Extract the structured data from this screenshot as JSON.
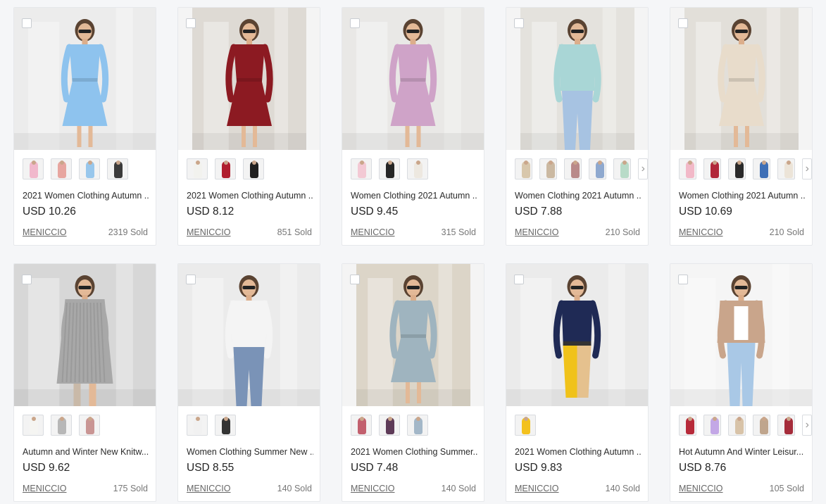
{
  "products": [
    {
      "title": "2021 Women Clothing Autumn ...",
      "price": "USD 10.26",
      "seller": "MENICCIO",
      "sold": "2319 Sold",
      "photo": {
        "bg": "#ececec",
        "outfit": "#8ec3ee",
        "accent": "#ffffff",
        "style": "dress",
        "fit": "full"
      },
      "swatches": [
        "#f1b8cc",
        "#e7a6a0",
        "#98c7ec",
        "#3b3b3b"
      ],
      "more": false
    },
    {
      "title": "2021 Women Clothing Autumn ...",
      "price": "USD 8.12",
      "seller": "MENICCIO",
      "sold": "851 Sold",
      "photo": {
        "bg": "#dedad4",
        "outfit": "#8c1a22",
        "accent": "#8c1a22",
        "style": "dress",
        "fit": "narrow"
      },
      "swatches": [
        "#f2f2ee",
        "#b01e2e",
        "#1f1f1f"
      ],
      "more": false
    },
    {
      "title": "Women Clothing 2021 Autumn ...",
      "price": "USD 9.45",
      "seller": "MENICCIO",
      "sold": "315 Sold",
      "photo": {
        "bg": "#e9e8e6",
        "outfit": "#cfa3c8",
        "accent": "#cfa3c8",
        "style": "dress",
        "fit": "full"
      },
      "swatches": [
        "#f3c9d4",
        "#262626",
        "#ede8e0"
      ],
      "more": false
    },
    {
      "title": "Women Clothing 2021 Autumn ...",
      "price": "USD 7.88",
      "seller": "MENICCIO",
      "sold": "210 Sold",
      "photo": {
        "bg": "#e4e2dd",
        "outfit": "#a9d6d6",
        "accent": "#a7c3e2",
        "style": "top",
        "fit": "narrow"
      },
      "swatches": [
        "#d8c7ac",
        "#cbb9a2",
        "#b98a8a",
        "#8fa9cf",
        "#b8dbc8"
      ],
      "more": true
    },
    {
      "title": "Women Clothing 2021 Autumn ...",
      "price": "USD 10.69",
      "seller": "MENICCIO",
      "sold": "210 Sold",
      "photo": {
        "bg": "#e2dfd9",
        "outfit": "#e8dccb",
        "accent": "#e8dccb",
        "style": "dress",
        "fit": "narrow"
      },
      "swatches": [
        "#f2b9c8",
        "#b1283a",
        "#2a2a2a",
        "#3e6fb6",
        "#ece4d8"
      ],
      "more": true
    },
    {
      "title": "Autumn and Winter New Knitw...",
      "price": "USD 9.62",
      "seller": "MENICCIO",
      "sold": "175 Sold",
      "photo": {
        "bg": "#d7d7d7",
        "outfit": "#a8a8a8",
        "accent": "#a8a8a8",
        "style": "sweater",
        "fit": "full"
      },
      "swatches": [
        "#f5f5f2",
        "#b7b7b7",
        "#c99594"
      ],
      "more": false
    },
    {
      "title": "Women Clothing Summer New ...",
      "price": "USD 8.55",
      "seller": "MENICCIO",
      "sold": "140 Sold",
      "photo": {
        "bg": "#ebebeb",
        "outfit": "#f4f4f4",
        "accent": "#7a93b7",
        "style": "top",
        "fit": "full"
      },
      "swatches": [
        "#f1f1f1",
        "#333333"
      ],
      "more": false
    },
    {
      "title": "2021 Women Clothing Summer...",
      "price": "USD 7.48",
      "seller": "MENICCIO",
      "sold": "140 Sold",
      "photo": {
        "bg": "#dcd5c8",
        "outfit": "#9fb4bf",
        "accent": "#9fb4bf",
        "style": "dress",
        "fit": "narrow"
      },
      "swatches": [
        "#c2606e",
        "#5e3b58",
        "#a3b7c8"
      ],
      "more": false
    },
    {
      "title": "2021 Women Clothing Autumn ...",
      "price": "USD 9.83",
      "seller": "MENICCIO",
      "sold": "140 Sold",
      "photo": {
        "bg": "#ebebeb",
        "outfit": "#1f2a55",
        "accent": "#e5c18e",
        "style": "twotone",
        "fit": "full"
      },
      "swatches": [
        "#f3c11e"
      ],
      "more": false
    },
    {
      "title": "Hot Autumn And Winter Leisur...",
      "price": "USD 8.76",
      "seller": "MENICCIO",
      "sold": "105 Sold",
      "photo": {
        "bg": "#f5f5f5",
        "outfit": "#c9a58b",
        "accent": "#a9c8e6",
        "style": "jacket",
        "fit": "full"
      },
      "swatches": [
        "#b72a3a",
        "#c3a7e6",
        "#d8c3a8",
        "#bfa58d",
        "#a52c3a"
      ],
      "more": true
    }
  ]
}
